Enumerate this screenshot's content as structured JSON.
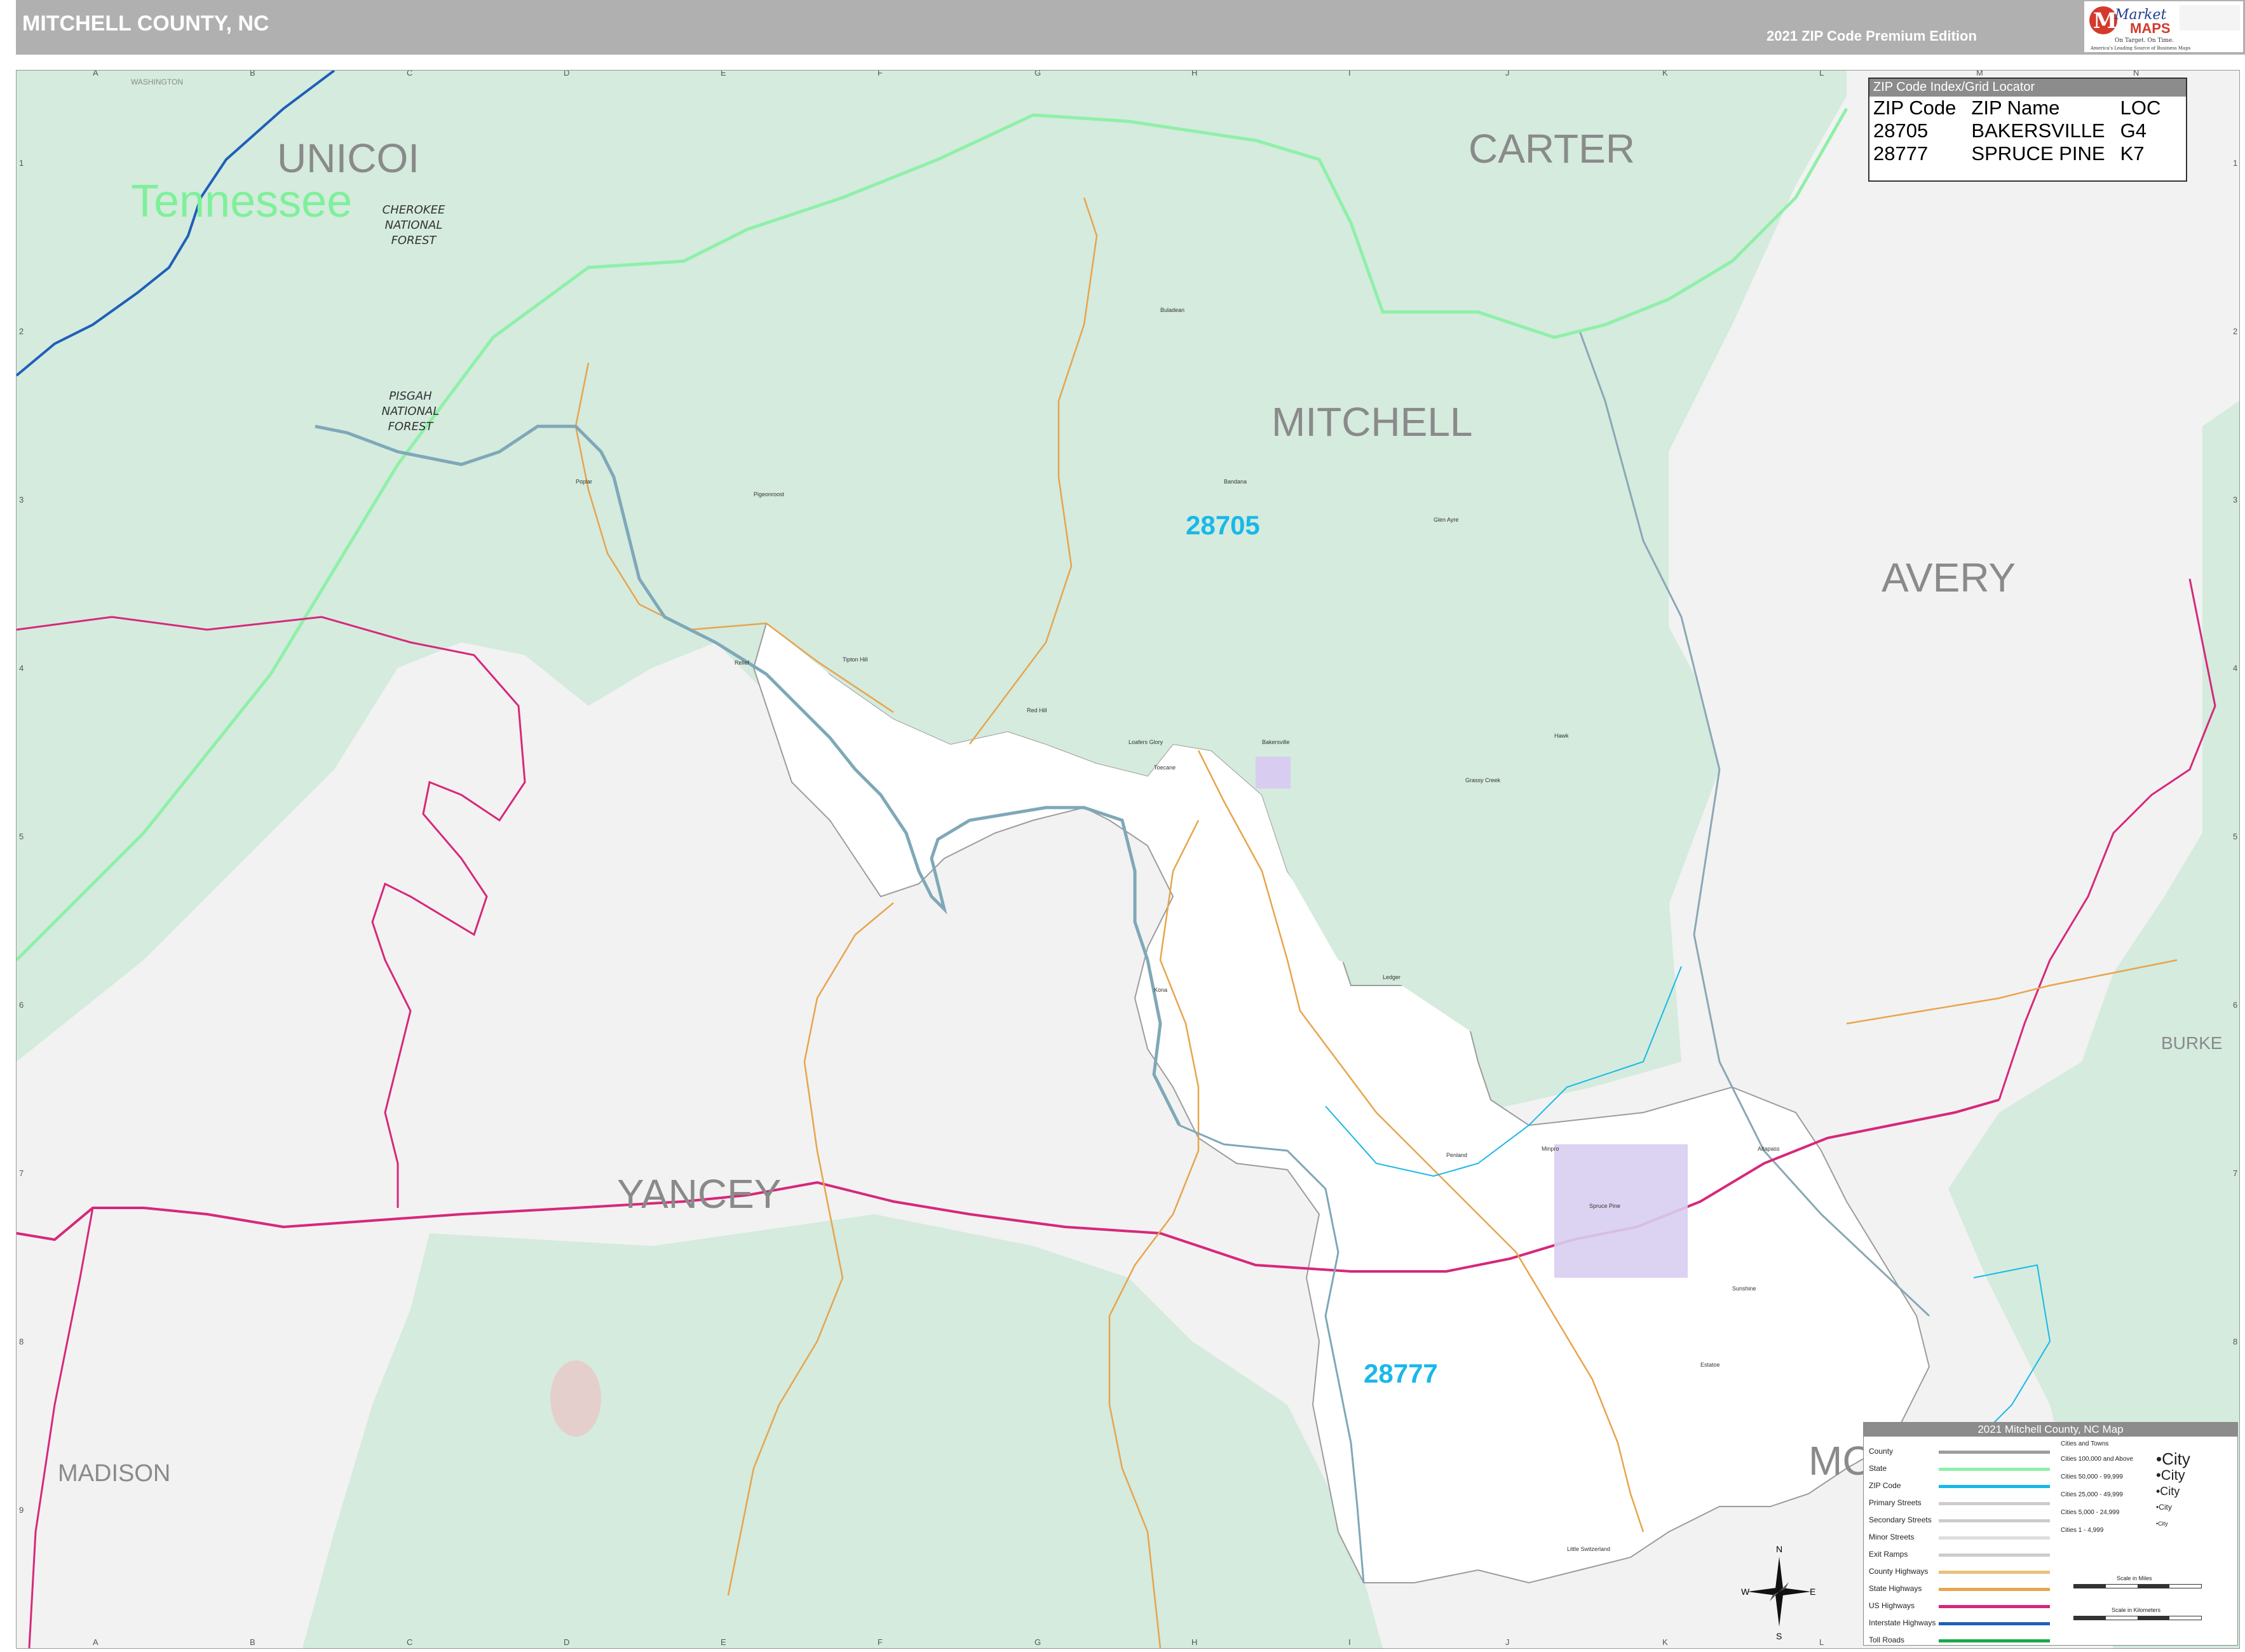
{
  "header": {
    "title": "MITCHELL COUNTY, NC",
    "edition": "2021 ZIP Code Premium Edition",
    "logo": {
      "brand_market": "Market",
      "brand_maps": "MAPS",
      "tagline": "On Target. On Time.",
      "subtag": "America's Leading Source of Business Maps"
    }
  },
  "colors": {
    "header_bg": "#b0b0b0",
    "forest_green": "#d4ebde",
    "neighbor_gray": "#f2f2f2",
    "county_white": "#ffffff",
    "state_line": "#8ff0a8",
    "zip_cyan": "#19b8e8",
    "us_highway": "#d6287a",
    "interstate": "#1f5fb8",
    "state_highway": "#e8a44c",
    "river": "#7fa8b8",
    "city_purple": "#d8cdf0"
  },
  "grid": {
    "columns": [
      "A",
      "B",
      "C",
      "D",
      "E",
      "F",
      "G",
      "H",
      "I",
      "J",
      "K",
      "L",
      "M",
      "N"
    ],
    "rows": [
      "1",
      "2",
      "3",
      "4",
      "5",
      "6",
      "7",
      "8",
      "9"
    ]
  },
  "labels": {
    "state_washington": "WASHINGTON",
    "state_tennessee": "Tennessee",
    "counties": {
      "unicoi": "UNICOI",
      "carter": "CARTER",
      "mitchell": "MITCHELL",
      "avery": "AVERY",
      "yancey": "YANCEY",
      "madison": "MADISON",
      "burke": "BURKE",
      "mcdowell_partial": "MC"
    },
    "forests": {
      "cherokee": [
        "CHEROKEE",
        "NATIONAL",
        "FOREST"
      ],
      "pisgah": [
        "PISGAH",
        "NATIONAL",
        "FOREST"
      ]
    },
    "zips": {
      "zip_28705": "28705",
      "zip_28777": "28777"
    },
    "places": [
      "Poplar",
      "Pigeonroost",
      "Bandana",
      "Bakersville",
      "Red Hill",
      "Tipton Hill",
      "Relief",
      "Loafers Glory",
      "Toecane",
      "Glen Ayre",
      "Buladean",
      "Hawk",
      "Grassy Creek",
      "Ledger",
      "Penland",
      "Spruce Pine",
      "Little Switzerland",
      "Kona",
      "Minpro",
      "Altapass",
      "Estatoe",
      "Sunshine"
    ]
  },
  "zip_index": {
    "title": "ZIP Code Index/Grid Locator",
    "columns": [
      "ZIP Code",
      "ZIP Name",
      "LOC"
    ],
    "rows": [
      [
        "28705",
        "BAKERSVILLE",
        "G4"
      ],
      [
        "28777",
        "SPRUCE PINE",
        "K7"
      ]
    ]
  },
  "legend": {
    "title": "2021 Mitchell County, NC Map",
    "line_items": [
      "County",
      "State",
      "ZIP Code",
      "Primary Streets",
      "Secondary Streets",
      "Minor Streets",
      "Exit Ramps",
      "County Highways",
      "State Highways",
      "US Highways",
      "Interstate Highways",
      "Toll Roads"
    ],
    "cities_header": "Cities and Towns",
    "city_items": [
      {
        "label": "Cities 100,000 and Above",
        "sample": "City"
      },
      {
        "label": "Cities 50,000 - 99,999",
        "sample": "City"
      },
      {
        "label": "Cities 25,000 - 49,999",
        "sample": "City"
      },
      {
        "label": "Cities 5,000 - 24,999",
        "sample": "City"
      },
      {
        "label": "Cities 1 - 4,999",
        "sample": "City"
      }
    ],
    "scale_miles": "Scale in Miles",
    "scale_km": "Scale in Kilometers"
  },
  "compass": {
    "n": "N",
    "s": "S",
    "e": "E",
    "w": "W"
  }
}
